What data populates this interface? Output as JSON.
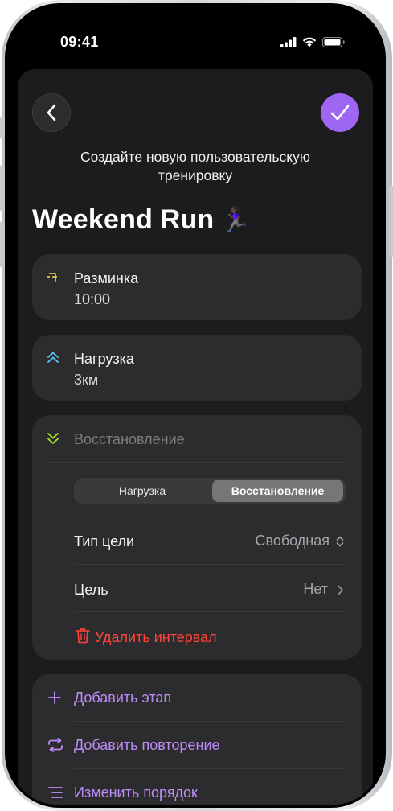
{
  "status_bar": {
    "time": "09:41"
  },
  "header": {
    "subtitle": "Создайте новую пользовательскую тренировку",
    "title": "Weekend Run",
    "title_emoji": "🏃🏿‍♀️"
  },
  "steps": [
    {
      "label": "Разминка",
      "value": "10:00",
      "icon": "warmup-icon",
      "icon_color": "#f5d33b"
    },
    {
      "label": "Нагрузка",
      "value": "3км",
      "icon": "double-chevron-up-icon",
      "icon_color": "#5ac8fa"
    }
  ],
  "recovery": {
    "label": "Восстановление",
    "icon": "double-chevron-down-icon",
    "icon_color": "#a8e619",
    "segment": {
      "options": [
        "Нагрузка",
        "Восстановление"
      ],
      "selected": "Восстановление"
    },
    "goal_type": {
      "label": "Тип цели",
      "value": "Свободная"
    },
    "goal": {
      "label": "Цель",
      "value": "Нет"
    },
    "delete_label": "Удалить интервал",
    "delete_color": "#ff453a"
  },
  "actions": [
    {
      "label": "Добавить этап",
      "icon": "plus-icon"
    },
    {
      "label": "Добавить повторение",
      "icon": "repeat-icon"
    },
    {
      "label": "Изменить порядок",
      "icon": "reorder-icon"
    }
  ],
  "colors": {
    "accent": "#9e66f2",
    "action_text": "#bd8cf8",
    "sheet": "#1c1c1e",
    "card": "#2c2c2e"
  }
}
